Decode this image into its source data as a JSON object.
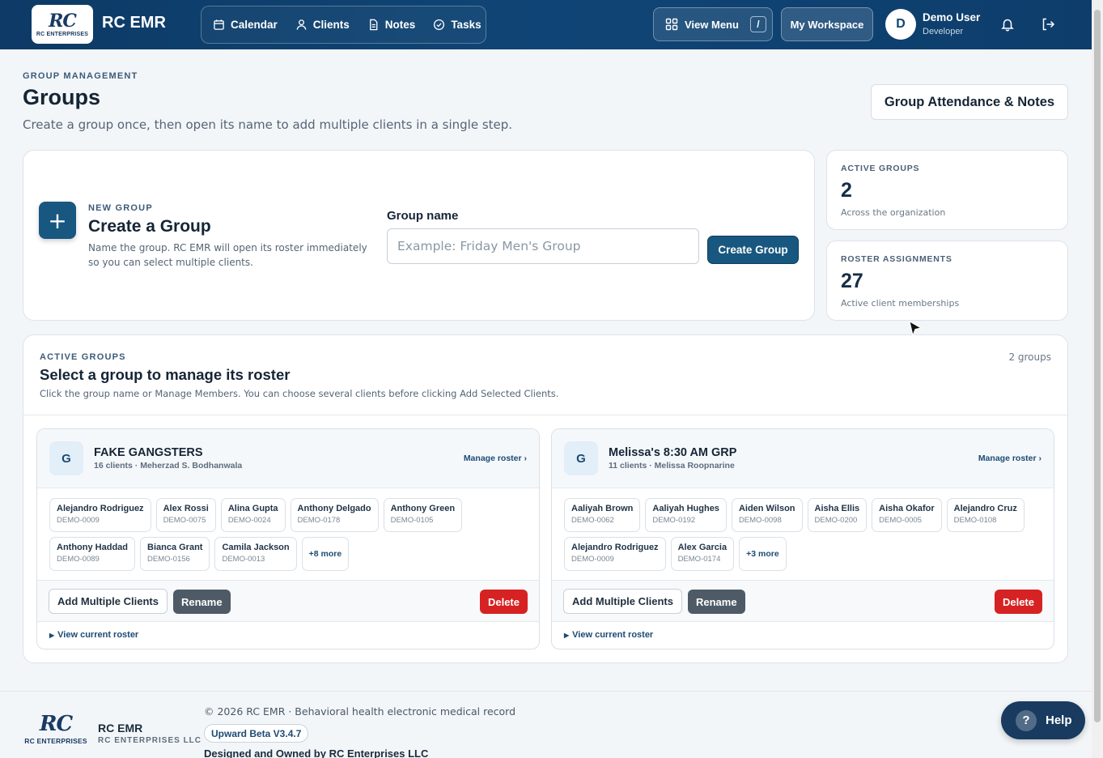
{
  "header": {
    "logo_text": "RC",
    "logo_sub": "RC ENTERPRISES",
    "brand": "RC EMR",
    "nav": [
      {
        "label": "Calendar",
        "icon": "calendar-icon"
      },
      {
        "label": "Clients",
        "icon": "person-icon"
      },
      {
        "label": "Notes",
        "icon": "document-icon"
      },
      {
        "label": "Tasks",
        "icon": "check-circle-icon"
      }
    ],
    "view_menu_label": "View Menu",
    "view_menu_shortcut": "/",
    "workspace_label": "My Workspace",
    "user_initial": "D",
    "user_name": "Demo User",
    "user_role": "Developer"
  },
  "page": {
    "eyebrow": "GROUP MANAGEMENT",
    "title": "Groups",
    "subtitle": "Create a group once, then open its name to add multiple clients in a single step.",
    "attendance_button": "Group Attendance & Notes"
  },
  "create": {
    "eyebrow": "NEW GROUP",
    "title": "Create a Group",
    "description": "Name the group. RC EMR will open its roster immediately so you can select multiple clients.",
    "field_label": "Group name",
    "placeholder": "Example: Friday Men's Group",
    "button_label": "Create Group"
  },
  "stats": [
    {
      "eyebrow": "ACTIVE GROUPS",
      "value": "2",
      "desc": "Across the organization"
    },
    {
      "eyebrow": "ROSTER ASSIGNMENTS",
      "value": "27",
      "desc": "Active client memberships"
    }
  ],
  "groups_panel": {
    "eyebrow": "ACTIVE GROUPS",
    "title": "Select a group to manage its roster",
    "description": "Click the group name or Manage Members. You can choose several clients before clicking Add Selected Clients.",
    "count": "2 groups"
  },
  "groups": [
    {
      "initial": "G",
      "name": "FAKE GANGSTERS",
      "meta": "16 clients · Meherzad S. Bodhanwala",
      "manage": "Manage roster ›",
      "clients": [
        {
          "name": "Alejandro Rodriguez",
          "id": "DEMO-0009"
        },
        {
          "name": "Alex Rossi",
          "id": "DEMO-0075"
        },
        {
          "name": "Alina Gupta",
          "id": "DEMO-0024"
        },
        {
          "name": "Anthony Delgado",
          "id": "DEMO-0178"
        },
        {
          "name": "Anthony Green",
          "id": "DEMO-0105"
        },
        {
          "name": "Anthony Haddad",
          "id": "DEMO-0089"
        },
        {
          "name": "Bianca Grant",
          "id": "DEMO-0156"
        },
        {
          "name": "Camila Jackson",
          "id": "DEMO-0013"
        }
      ],
      "more": "+8 more",
      "add_label": "Add Multiple Clients",
      "rename_label": "Rename",
      "delete_label": "Delete",
      "view_label": "View current roster"
    },
    {
      "initial": "G",
      "name": "Melissa's 8:30 AM GRP",
      "meta": "11 clients · Melissa Roopnarine",
      "manage": "Manage roster ›",
      "clients": [
        {
          "name": "Aaliyah Brown",
          "id": "DEMO-0062"
        },
        {
          "name": "Aaliyah Hughes",
          "id": "DEMO-0192"
        },
        {
          "name": "Aiden Wilson",
          "id": "DEMO-0098"
        },
        {
          "name": "Aisha Ellis",
          "id": "DEMO-0200"
        },
        {
          "name": "Aisha Okafor",
          "id": "DEMO-0005"
        },
        {
          "name": "Alejandro Cruz",
          "id": "DEMO-0108"
        },
        {
          "name": "Alejandro Rodriguez",
          "id": "DEMO-0009"
        },
        {
          "name": "Alex Garcia",
          "id": "DEMO-0174"
        }
      ],
      "more": "+3 more",
      "add_label": "Add Multiple Clients",
      "rename_label": "Rename",
      "delete_label": "Delete",
      "view_label": "View current roster"
    }
  ],
  "footer": {
    "logo_text": "RC",
    "logo_sub": "RC ENTERPRISES",
    "brand": "RC EMR",
    "brand_sub": "RC ENTERPRISES LLC",
    "copyright": "© 2026 RC EMR · Behavioral health electronic medical record",
    "version": "Upward Beta V3.4.7",
    "owned": "Designed and Owned by RC Enterprises LLC"
  },
  "help": {
    "icon": "?",
    "label": "Help"
  },
  "colors": {
    "nav_bg": "#0f4576",
    "primary": "#18577f",
    "danger": "#d62222",
    "neutral_button": "#4e5a66"
  }
}
